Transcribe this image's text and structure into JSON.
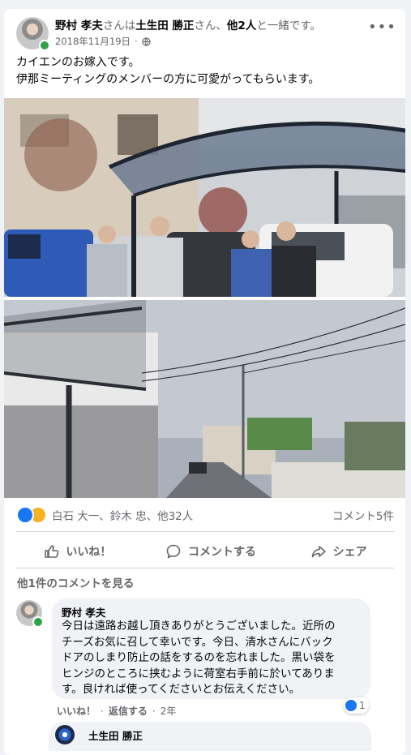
{
  "post": {
    "author": "野村 孝夫",
    "with_text": "さんは",
    "tagged_user": "土生田 勝正",
    "tagged_suffix": "さん、",
    "others": "他2人",
    "others_suffix": "と一緒です。",
    "date": "2018年11月19日",
    "privacy_icon": "globe-icon",
    "body_lines": [
      "カイエンのお嫁入です。",
      "伊那ミーティングのメンバーの方に可愛がってもらいます。"
    ]
  },
  "reactions": {
    "icons": [
      "like-icon",
      "sad-icon"
    ],
    "names": "白石 大一、鈴木 忠、他32人",
    "comments_count": "コメント5件"
  },
  "actions": {
    "like": "いいね！",
    "comment": "コメントする",
    "share": "シェア"
  },
  "comments": {
    "see_more": "他1件のコメントを見る",
    "first": {
      "author": "野村 孝夫",
      "text_lines": [
        "今日は遠路お越し頂きありがとうございました。近所の",
        "チーズお気に召して幸いです。今日、清水さんにバック",
        "ドアのしまり防止の話をするのを忘れました。黒い袋を",
        "ヒンジのところに挟むように荷室右手前に於いてありま",
        "す。良ければ使ってくださいとお伝えください。"
      ],
      "like_count": "1",
      "like_label": "いいね！",
      "reply_label": "返信する",
      "age": "2年"
    },
    "reply_author": "土生田 勝正"
  },
  "colors": {
    "accent": "#1877f2",
    "muted": "#65676b",
    "online": "#31a24c"
  }
}
